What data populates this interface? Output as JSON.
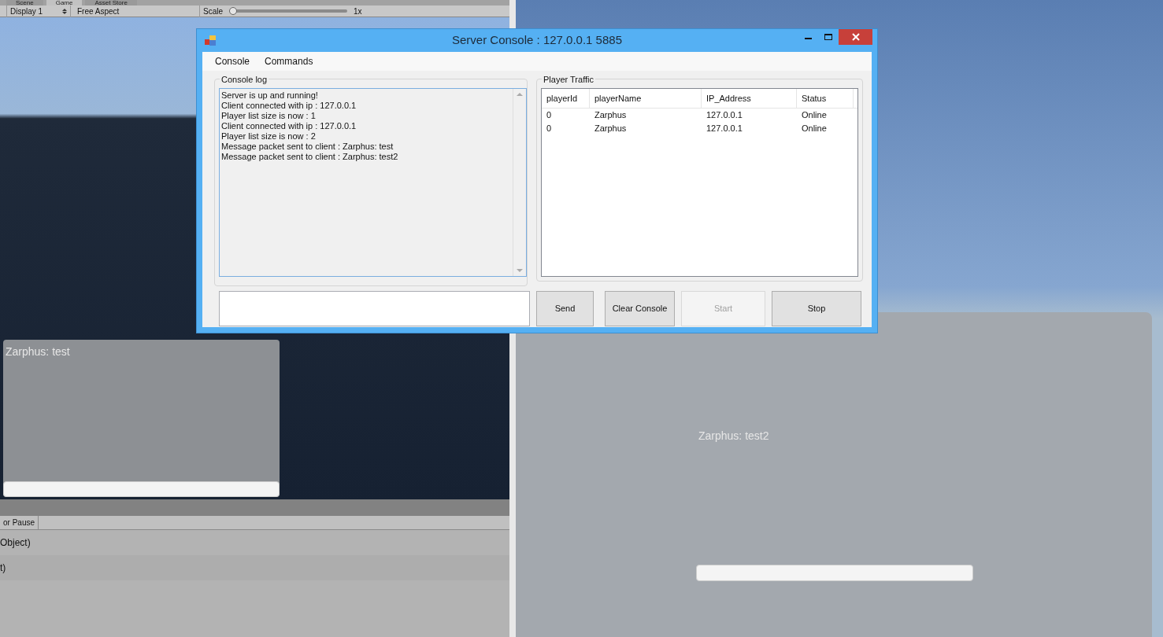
{
  "editor": {
    "tabs": [
      {
        "label": "Scene",
        "selected": false
      },
      {
        "label": "Game",
        "selected": true
      },
      {
        "label": "Asset Store",
        "selected": false
      }
    ],
    "display": "Display 1",
    "aspect": "Free Aspect",
    "scale_label": "Scale",
    "scale_slider": {
      "level": 0.0
    },
    "scale_value": "1x",
    "left_game": {
      "chat_message": "Zarphus: test"
    },
    "bottom_panel": {
      "toolbar_label": "or Pause",
      "rows": [
        "Object)",
        "t)"
      ]
    },
    "right_game": {
      "chat_message": "Zarphus: test2"
    }
  },
  "server_window": {
    "title": "Server Console : 127.0.0.1 5885",
    "menu": [
      "Console",
      "Commands"
    ],
    "console_log": {
      "label": "Console log",
      "lines": [
        "Server is up and running!",
        "Client connected with ip : 127.0.0.1",
        "Player list size is now : 1",
        "Client connected with ip : 127.0.0.1",
        "Player list size is now : 2",
        "Message packet sent to client : Zarphus: test",
        "Message packet sent to client : Zarphus: test2"
      ]
    },
    "player_traffic": {
      "label": "Player Traffic",
      "columns": [
        "playerId",
        "playerName",
        "IP_Address",
        "Status"
      ],
      "rows": [
        [
          "0",
          "Zarphus",
          "127.0.0.1",
          "Online"
        ],
        [
          "0",
          "Zarphus",
          "127.0.0.1",
          "Online"
        ]
      ]
    },
    "buttons": [
      {
        "label": "Send",
        "disabled": false
      },
      {
        "label": "Clear Console",
        "disabled": false
      },
      {
        "label": "Start",
        "disabled": true
      },
      {
        "label": "Stop",
        "disabled": false
      }
    ]
  }
}
